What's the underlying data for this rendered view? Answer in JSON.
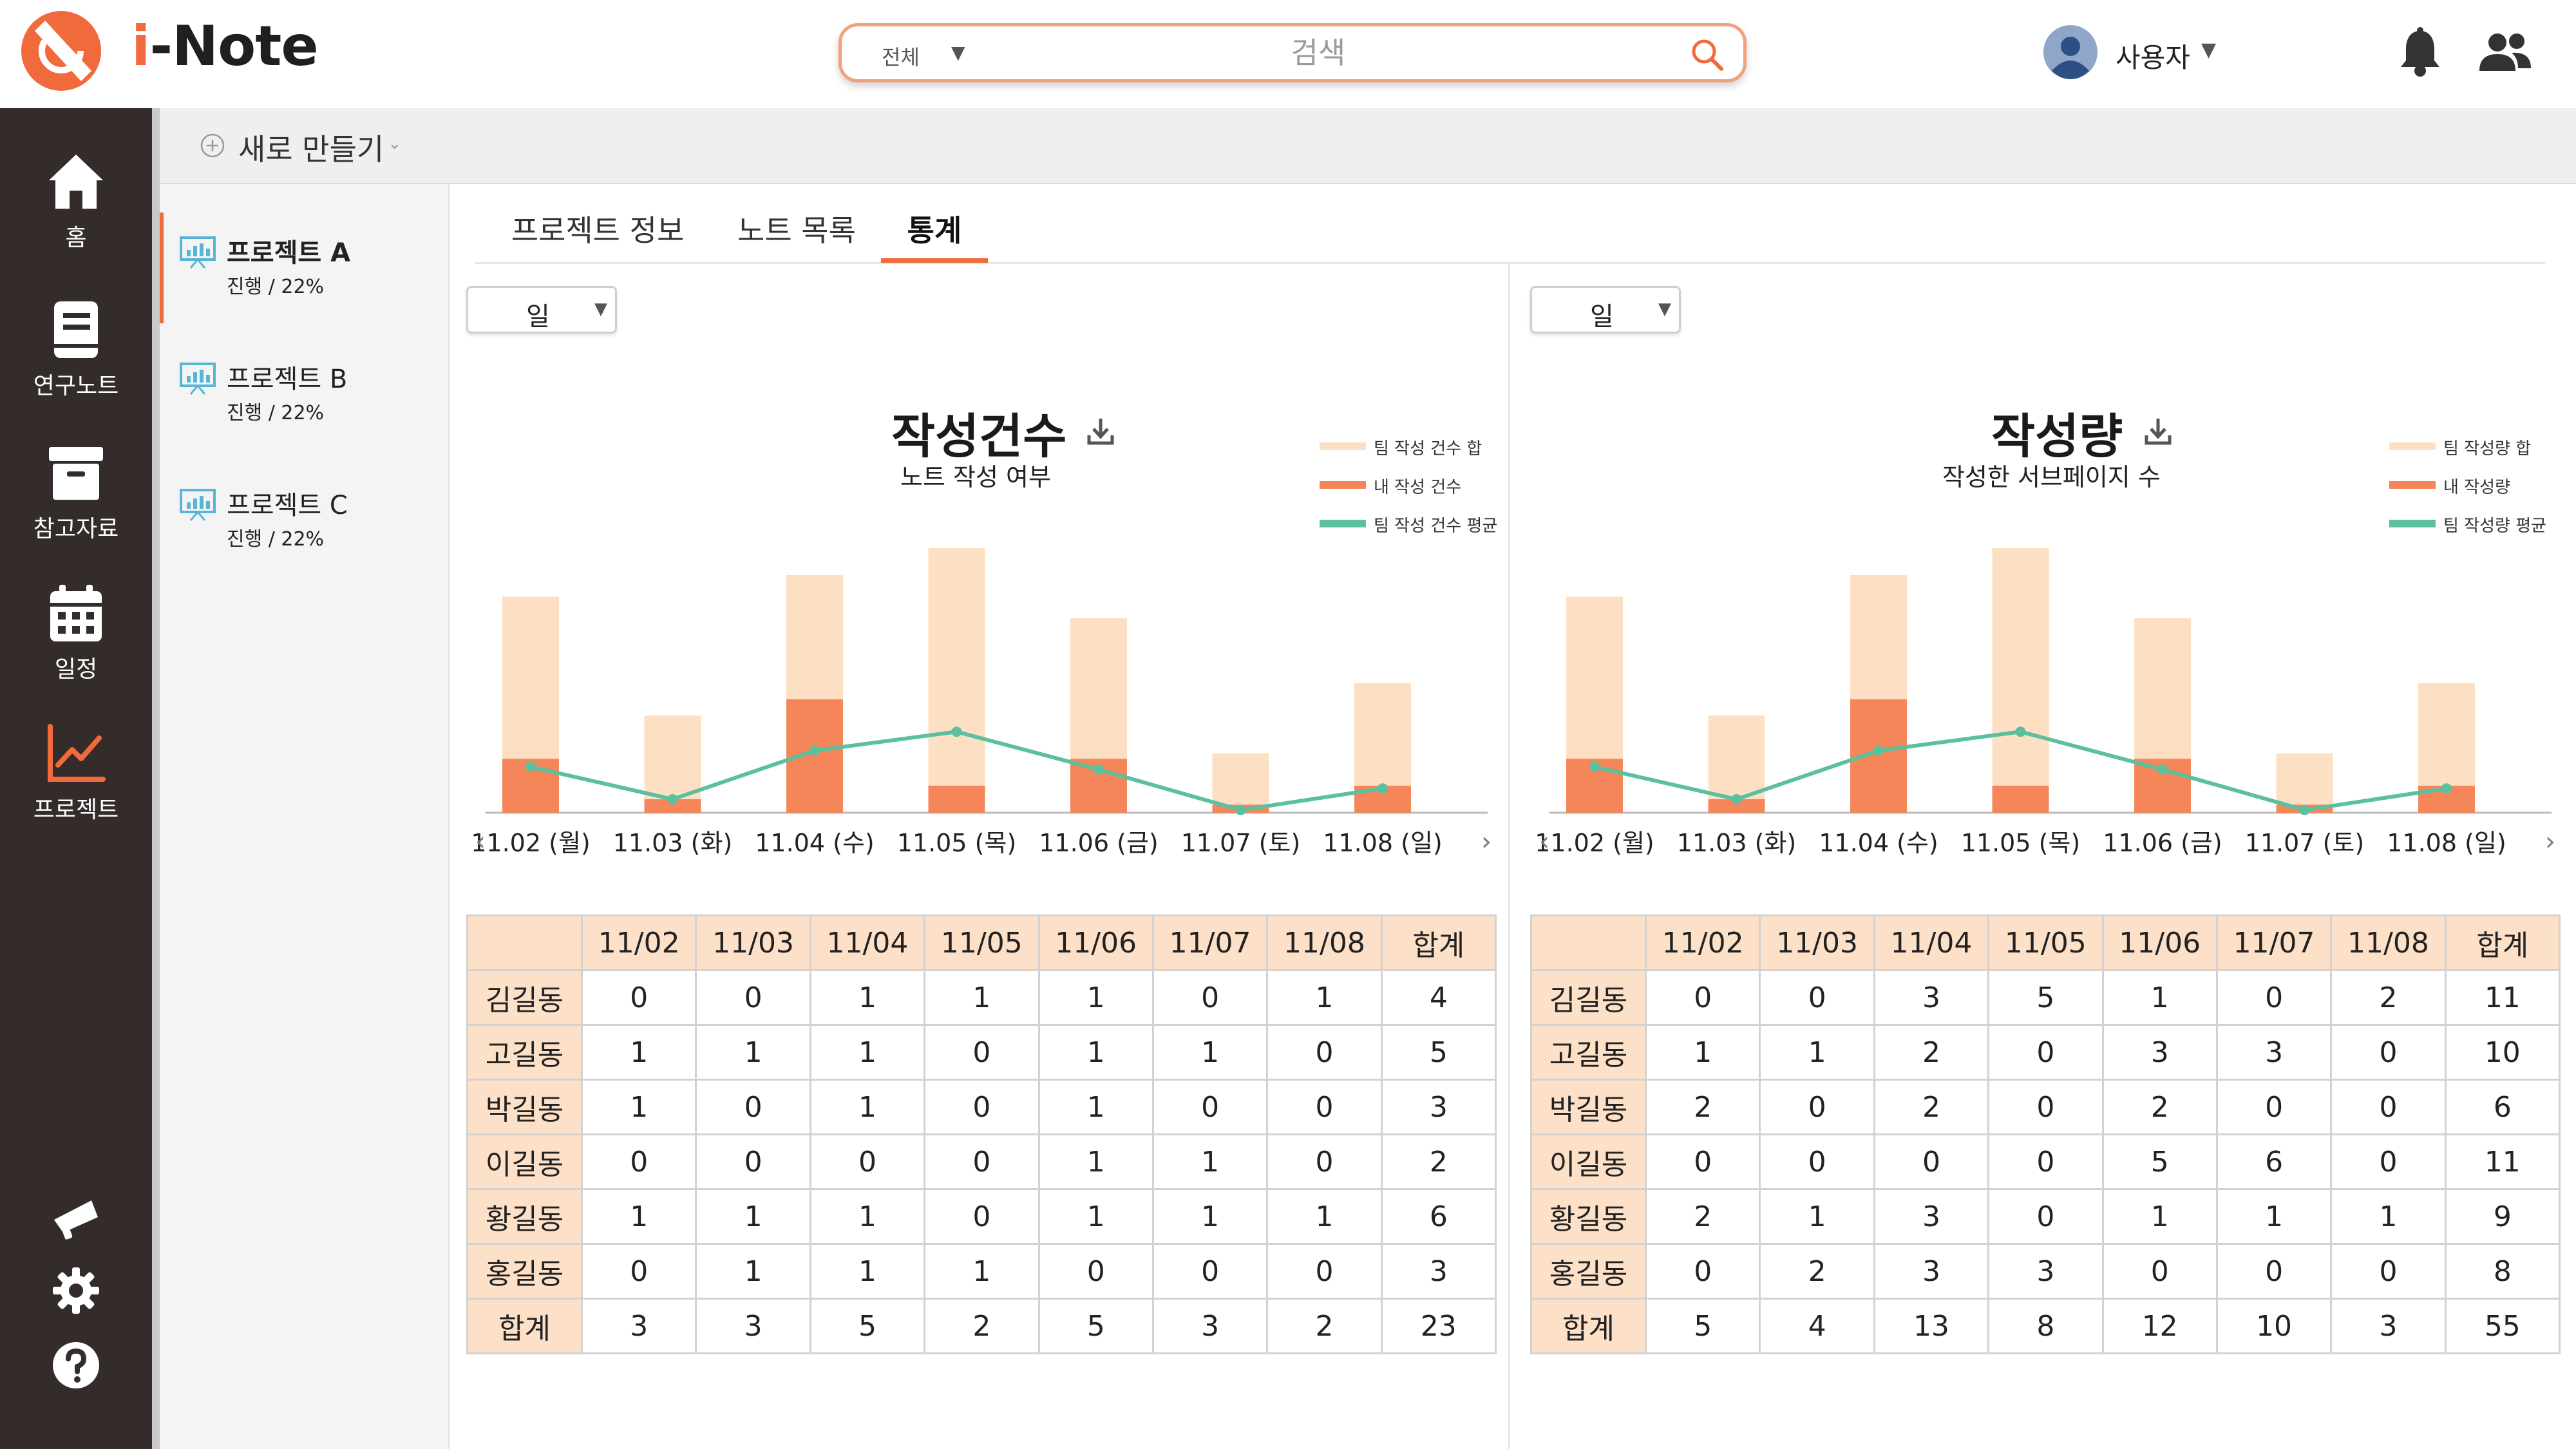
{
  "header": {
    "app_name_prefix": "i",
    "app_name_suffix": "-Note",
    "search": {
      "scope": "전체",
      "placeholder": "검색"
    },
    "user": {
      "name": "사용자"
    }
  },
  "sidebar": {
    "items": [
      {
        "label": "홈",
        "icon": "home-icon"
      },
      {
        "label": "연구노트",
        "icon": "notebook-icon"
      },
      {
        "label": "참고자료",
        "icon": "archive-icon"
      },
      {
        "label": "일정",
        "icon": "calendar-icon"
      },
      {
        "label": "프로젝트",
        "icon": "chart-line-icon",
        "active": true
      }
    ],
    "bottom_icons": [
      "megaphone-icon",
      "gear-icon",
      "help-icon"
    ]
  },
  "toolbar": {
    "new_label": "새로 만들기"
  },
  "projects": [
    {
      "name": "프로젝트 A",
      "status": "진행 / 22%",
      "active": true
    },
    {
      "name": "프로젝트 B",
      "status": "진행 / 22%",
      "active": false
    },
    {
      "name": "프로젝트 C",
      "status": "진행 / 22%",
      "active": false
    }
  ],
  "tabs": [
    {
      "label": "프로젝트 정보",
      "active": false
    },
    {
      "label": "노트 목록",
      "active": false
    },
    {
      "label": "통계",
      "active": true
    }
  ],
  "colors": {
    "accent": "#f06a3c",
    "team_sum": "#fde0c4",
    "mine": "#f5865a",
    "team_avg": "#5cbf9e"
  },
  "panels": [
    {
      "period": "일",
      "title": "작성건수",
      "subtitle": "노트 작성 여부",
      "nav_prev": "‹",
      "nav_next": "›",
      "chart_data": {
        "type": "bar",
        "categories": [
          "11.02 (월)",
          "11.03 (화)",
          "11.04 (수)",
          "11.05 (목)",
          "11.06 (금)",
          "11.07 (토)",
          "11.08 (일)"
        ],
        "series": [
          {
            "name": "팀 작성 건수 합",
            "type": "bar",
            "values": [
              8.0,
              3.6,
              8.8,
              9.8,
              7.2,
              2.2,
              4.8
            ]
          },
          {
            "name": "내 작성 건수",
            "type": "bar",
            "values": [
              2.0,
              0.5,
              4.2,
              1.0,
              2.0,
              0.3,
              1.0
            ]
          },
          {
            "name": "팀 작성 건수 평균",
            "type": "line",
            "values": [
              1.7,
              0.5,
              2.3,
              3.0,
              1.6,
              0.1,
              0.9
            ]
          }
        ],
        "ylim": [
          0,
          10
        ]
      },
      "table": {
        "columns": [
          "11/02",
          "11/03",
          "11/04",
          "11/05",
          "11/06",
          "11/07",
          "11/08",
          "합계"
        ],
        "rows": [
          {
            "name": "김길동",
            "values": [
              "0",
              "0",
              "1",
              "1",
              "1",
              "0",
              "1",
              "4"
            ]
          },
          {
            "name": "고길동",
            "values": [
              "1",
              "1",
              "1",
              "0",
              "1",
              "1",
              "0",
              "5"
            ]
          },
          {
            "name": "박길동",
            "values": [
              "1",
              "0",
              "1",
              "0",
              "1",
              "0",
              "0",
              "3"
            ]
          },
          {
            "name": "이길동",
            "values": [
              "0",
              "0",
              "0",
              "0",
              "1",
              "1",
              "0",
              "2"
            ]
          },
          {
            "name": "황길동",
            "values": [
              "1",
              "1",
              "1",
              "0",
              "1",
              "1",
              "1",
              "6"
            ]
          },
          {
            "name": "홍길동",
            "values": [
              "0",
              "1",
              "1",
              "1",
              "0",
              "0",
              "0",
              "3"
            ]
          },
          {
            "name": "합계",
            "values": [
              "3",
              "3",
              "5",
              "2",
              "5",
              "3",
              "2",
              "23"
            ]
          }
        ]
      }
    },
    {
      "period": "일",
      "title": "작성량",
      "subtitle": "작성한 서브페이지 수",
      "nav_prev": "‹",
      "nav_next": "›",
      "chart_data": {
        "type": "bar",
        "categories": [
          "11.02 (월)",
          "11.03 (화)",
          "11.04 (수)",
          "11.05 (목)",
          "11.06 (금)",
          "11.07 (토)",
          "11.08 (일)"
        ],
        "series": [
          {
            "name": "팀 작성량 합",
            "type": "bar",
            "values": [
              8.0,
              3.6,
              8.8,
              9.8,
              7.2,
              2.2,
              4.8
            ]
          },
          {
            "name": "내 작성량",
            "type": "bar",
            "values": [
              2.0,
              0.5,
              4.2,
              1.0,
              2.0,
              0.3,
              1.0
            ]
          },
          {
            "name": "팀 작성량 평균",
            "type": "line",
            "values": [
              1.7,
              0.5,
              2.3,
              3.0,
              1.6,
              0.1,
              0.9
            ]
          }
        ],
        "ylim": [
          0,
          10
        ]
      },
      "table": {
        "columns": [
          "11/02",
          "11/03",
          "11/04",
          "11/05",
          "11/06",
          "11/07",
          "11/08",
          "합계"
        ],
        "rows": [
          {
            "name": "김길동",
            "values": [
              "0",
              "0",
              "3",
              "5",
              "1",
              "0",
              "2",
              "11"
            ]
          },
          {
            "name": "고길동",
            "values": [
              "1",
              "1",
              "2",
              "0",
              "3",
              "3",
              "0",
              "10"
            ]
          },
          {
            "name": "박길동",
            "values": [
              "2",
              "0",
              "2",
              "0",
              "2",
              "0",
              "0",
              "6"
            ]
          },
          {
            "name": "이길동",
            "values": [
              "0",
              "0",
              "0",
              "0",
              "5",
              "6",
              "0",
              "11"
            ]
          },
          {
            "name": "황길동",
            "values": [
              "2",
              "1",
              "3",
              "0",
              "1",
              "1",
              "1",
              "9"
            ]
          },
          {
            "name": "홍길동",
            "values": [
              "0",
              "2",
              "3",
              "3",
              "0",
              "0",
              "0",
              "8"
            ]
          },
          {
            "name": "합계",
            "values": [
              "5",
              "4",
              "13",
              "8",
              "12",
              "10",
              "3",
              "55"
            ]
          }
        ]
      }
    }
  ]
}
